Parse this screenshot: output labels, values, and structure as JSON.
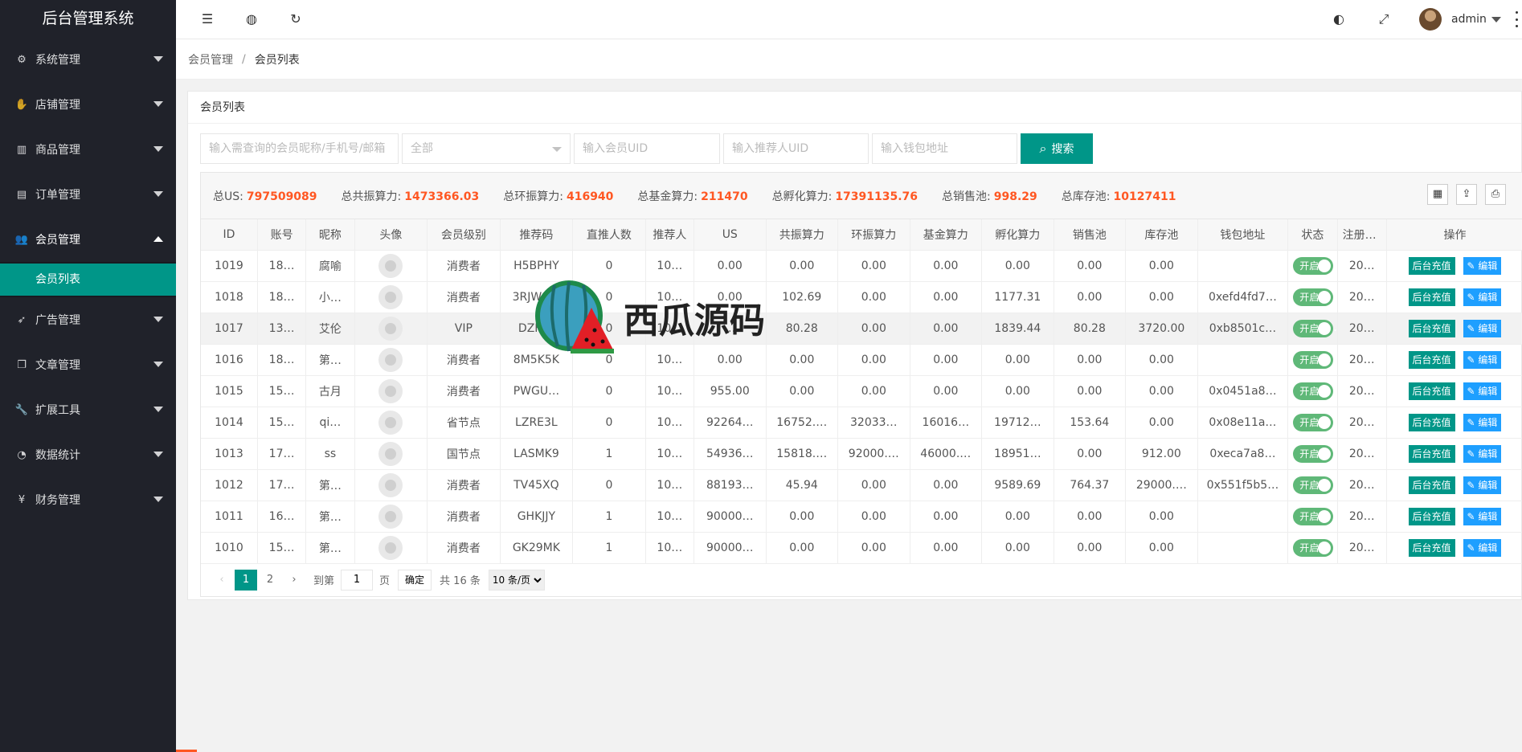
{
  "app_title": "后台管理系统",
  "sidebar": {
    "items": [
      {
        "icon": "gear-icon",
        "glyph": "⚙",
        "label": "系统管理",
        "open": false
      },
      {
        "icon": "hand-icon",
        "glyph": "✋",
        "label": "店铺管理",
        "open": false
      },
      {
        "icon": "bar-chart-icon",
        "glyph": "▥",
        "label": "商品管理",
        "open": false
      },
      {
        "icon": "calendar-icon",
        "glyph": "▤",
        "label": "订单管理",
        "open": false
      },
      {
        "icon": "users-icon",
        "glyph": "👥",
        "label": "会员管理",
        "open": true
      },
      {
        "icon": "rocket-icon",
        "glyph": "➶",
        "label": "广告管理",
        "open": false
      },
      {
        "icon": "copy-icon",
        "glyph": "❐",
        "label": "文章管理",
        "open": false
      },
      {
        "icon": "wrench-icon",
        "glyph": "🔧",
        "label": "扩展工具",
        "open": false
      },
      {
        "icon": "pie-chart-icon",
        "glyph": "◔",
        "label": "数据统计",
        "open": false
      },
      {
        "icon": "yen-icon",
        "glyph": "¥",
        "label": "财务管理",
        "open": false
      }
    ],
    "submenu": {
      "label": "会员列表"
    }
  },
  "header": {
    "user_name": "admin"
  },
  "breadcrumb": {
    "parent": "会员管理",
    "separator": "/",
    "current": "会员列表"
  },
  "card": {
    "title": "会员列表",
    "filters": {
      "keyword_placeholder": "输入需查询的会员昵称/手机号/邮箱",
      "level_select": "全部",
      "uid_placeholder": "输入会员UID",
      "referrer_placeholder": "输入推荐人UID",
      "wallet_placeholder": "输入钱包地址",
      "search_label": "搜索"
    },
    "totals": [
      {
        "label": "总US:",
        "value": "797509089"
      },
      {
        "label": "总共振算力:",
        "value": "1473366.03"
      },
      {
        "label": "总环振算力:",
        "value": "416940"
      },
      {
        "label": "总基金算力:",
        "value": "211470"
      },
      {
        "label": "总孵化算力:",
        "value": "17391135.76"
      },
      {
        "label": "总销售池:",
        "value": "998.29"
      },
      {
        "label": "总库存池:",
        "value": "10127411"
      }
    ],
    "columns": [
      "ID",
      "账号",
      "昵称",
      "头像",
      "会员级别",
      "推荐码",
      "直推人数",
      "推荐人",
      "US",
      "共振算力",
      "环振算力",
      "基金算力",
      "孵化算力",
      "销售池",
      "库存池",
      "钱包地址",
      "状态",
      "注册时间",
      "操作"
    ],
    "rows": [
      {
        "id": "1019",
        "account": "18…",
        "nick": "腐喻",
        "level": "消费者",
        "code": "H5BPHY",
        "direct": "0",
        "ref": "10…",
        "us": "0.00",
        "gz": "0.00",
        "hz": "0.00",
        "jj": "0.00",
        "fh": "0.00",
        "xs": "0.00",
        "kc": "0.00",
        "wallet": "",
        "status": "开启",
        "reg": "20…"
      },
      {
        "id": "1018",
        "account": "18…",
        "nick": "小…",
        "level": "消费者",
        "code": "3RJW9…",
        "direct": "0",
        "ref": "10…",
        "us": "0.00",
        "gz": "102.69",
        "hz": "0.00",
        "jj": "0.00",
        "fh": "1177.31",
        "xs": "0.00",
        "kc": "0.00",
        "wallet": "0xefd4fd7…",
        "status": "开启",
        "reg": "20…"
      },
      {
        "id": "1017",
        "account": "13…",
        "nick": "艾伦",
        "level": "VIP",
        "code": "DZH…",
        "direct": "0",
        "ref": "10…",
        "us": "…",
        "gz": "80.28",
        "hz": "0.00",
        "jj": "0.00",
        "fh": "1839.44",
        "xs": "80.28",
        "kc": "3720.00",
        "wallet": "0xb8501c…",
        "status": "开启",
        "reg": "20…"
      },
      {
        "id": "1016",
        "account": "18…",
        "nick": "第…",
        "level": "消费者",
        "code": "8M5K5K",
        "direct": "0",
        "ref": "10…",
        "us": "0.00",
        "gz": "0.00",
        "hz": "0.00",
        "jj": "0.00",
        "fh": "0.00",
        "xs": "0.00",
        "kc": "0.00",
        "wallet": "",
        "status": "开启",
        "reg": "20…"
      },
      {
        "id": "1015",
        "account": "15…",
        "nick": "古月",
        "level": "消费者",
        "code": "PWGU…",
        "direct": "0",
        "ref": "10…",
        "us": "955.00",
        "gz": "0.00",
        "hz": "0.00",
        "jj": "0.00",
        "fh": "0.00",
        "xs": "0.00",
        "kc": "0.00",
        "wallet": "0x0451a8…",
        "status": "开启",
        "reg": "20…"
      },
      {
        "id": "1014",
        "account": "15…",
        "nick": "qi…",
        "level": "省节点",
        "code": "LZRE3L",
        "direct": "0",
        "ref": "10…",
        "us": "92264…",
        "gz": "16752.…",
        "hz": "32033…",
        "jj": "16016…",
        "fh": "19712…",
        "xs": "153.64",
        "kc": "0.00",
        "wallet": "0x08e11a…",
        "status": "开启",
        "reg": "20…"
      },
      {
        "id": "1013",
        "account": "17…",
        "nick": "ss",
        "level": "国节点",
        "code": "LASMK9",
        "direct": "1",
        "ref": "10…",
        "us": "54936…",
        "gz": "15818.…",
        "hz": "92000.…",
        "jj": "46000.…",
        "fh": "18951…",
        "xs": "0.00",
        "kc": "912.00",
        "wallet": "0xeca7a8…",
        "status": "开启",
        "reg": "20…"
      },
      {
        "id": "1012",
        "account": "17…",
        "nick": "第…",
        "level": "消费者",
        "code": "TV45XQ",
        "direct": "0",
        "ref": "10…",
        "us": "88193…",
        "gz": "45.94",
        "hz": "0.00",
        "jj": "0.00",
        "fh": "9589.69",
        "xs": "764.37",
        "kc": "29000.…",
        "wallet": "0x551f5b5…",
        "status": "开启",
        "reg": "20…"
      },
      {
        "id": "1011",
        "account": "16…",
        "nick": "第…",
        "level": "消费者",
        "code": "GHKJJY",
        "direct": "1",
        "ref": "10…",
        "us": "90000…",
        "gz": "0.00",
        "hz": "0.00",
        "jj": "0.00",
        "fh": "0.00",
        "xs": "0.00",
        "kc": "0.00",
        "wallet": "",
        "status": "开启",
        "reg": "20…"
      },
      {
        "id": "1010",
        "account": "15…",
        "nick": "第…",
        "level": "消费者",
        "code": "GK29MK",
        "direct": "1",
        "ref": "10…",
        "us": "90000…",
        "gz": "0.00",
        "hz": "0.00",
        "jj": "0.00",
        "fh": "0.00",
        "xs": "0.00",
        "kc": "0.00",
        "wallet": "",
        "status": "开启",
        "reg": "20…"
      }
    ],
    "row_actions": {
      "recharge": "后台充值",
      "edit": "✎ 编辑"
    },
    "highlighted_row": "1017",
    "pager": {
      "pages": [
        "1",
        "2"
      ],
      "current": "1",
      "goto_label": "到第",
      "goto_value": "1",
      "page_unit": "页",
      "ok_label": "确定",
      "total_label": "共 16 条",
      "page_size": "10 条/页"
    }
  },
  "watermark": {
    "text": "西瓜源码"
  },
  "colors": {
    "primary": "#009688",
    "accent": "#ff5722",
    "edit": "#1e9fff",
    "switch": "#5fb878",
    "sidebar": "#20222a"
  }
}
